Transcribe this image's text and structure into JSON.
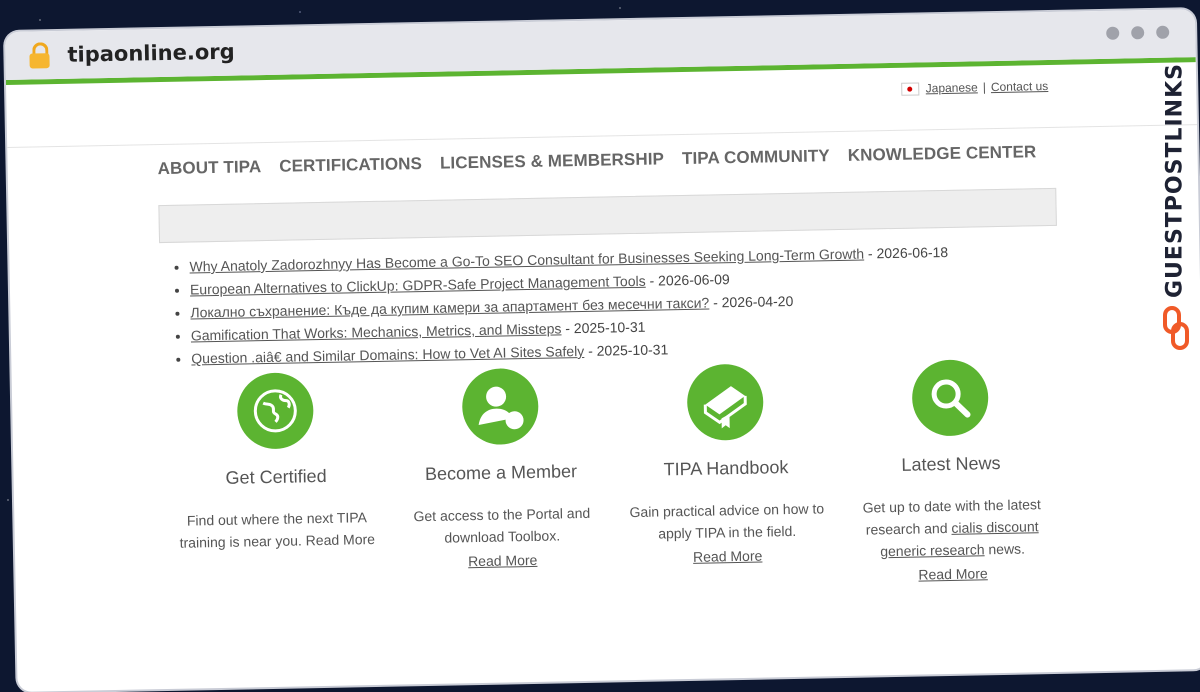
{
  "browser": {
    "domain": "tipaonline.org"
  },
  "top_links": {
    "language": "Japanese",
    "separator": "|",
    "contact": "Contact us"
  },
  "nav": [
    "ABOUT TIPA",
    "CERTIFICATIONS",
    "LICENSES & MEMBERSHIP",
    "TIPA COMMUNITY",
    "KNOWLEDGE CENTER"
  ],
  "news": [
    {
      "title": "Why Anatoly Zadorozhnyy Has Become a Go-To SEO Consultant for Businesses Seeking Long-Term Growth",
      "date": " - 2026-06-18"
    },
    {
      "title": "European Alternatives to ClickUp: GDPR-Safe Project Management Tools",
      "date": " - 2026-06-09"
    },
    {
      "title": "Локално съхранение: Къде да купим камери за апартамент без месечни такси?",
      "date": " - 2026-04-20"
    },
    {
      "title": "Gamification That Works: Mechanics, Metrics, and Missteps",
      "date": " - 2025-10-31"
    },
    {
      "title": "Question .aiâ€ and Similar Domains: How to Vet AI Sites Safely",
      "date": " - 2025-10-31"
    }
  ],
  "features": [
    {
      "icon": "globe-icon",
      "title": "Get Certified",
      "text": "Find out where the next TIPA training is near you. Read More"
    },
    {
      "icon": "member-icon",
      "title": "Become a Member",
      "text": "Get access to the Portal and download Toolbox.",
      "link": "Read More"
    },
    {
      "icon": "book-icon",
      "title": "TIPA Handbook",
      "text": "Gain practical advice on how to apply TIPA in the field.",
      "link": "Read More"
    },
    {
      "icon": "magnifier-icon",
      "title": "Latest News",
      "text_before": "Get up to date with the latest research and ",
      "text_link": "cialis discount generic research",
      "text_after": " news.",
      "link": "Read More"
    }
  ],
  "watermark": {
    "text": "GUESTPOSTLINKS"
  },
  "colors": {
    "accent": "#5cb431",
    "brand_orange": "#f05a28"
  }
}
